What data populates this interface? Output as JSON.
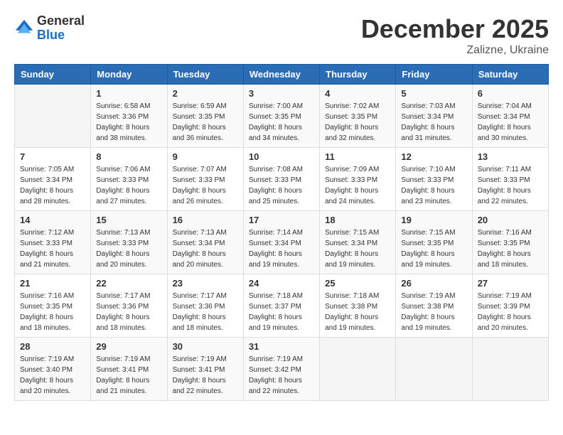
{
  "header": {
    "logo": {
      "general": "General",
      "blue": "Blue"
    },
    "title": "December 2025",
    "location": "Zalizne, Ukraine"
  },
  "weekdays": [
    "Sunday",
    "Monday",
    "Tuesday",
    "Wednesday",
    "Thursday",
    "Friday",
    "Saturday"
  ],
  "weeks": [
    [
      {
        "day": "",
        "sunrise": "",
        "sunset": "",
        "daylight": ""
      },
      {
        "day": "1",
        "sunrise": "Sunrise: 6:58 AM",
        "sunset": "Sunset: 3:36 PM",
        "daylight": "Daylight: 8 hours and 38 minutes."
      },
      {
        "day": "2",
        "sunrise": "Sunrise: 6:59 AM",
        "sunset": "Sunset: 3:35 PM",
        "daylight": "Daylight: 8 hours and 36 minutes."
      },
      {
        "day": "3",
        "sunrise": "Sunrise: 7:00 AM",
        "sunset": "Sunset: 3:35 PM",
        "daylight": "Daylight: 8 hours and 34 minutes."
      },
      {
        "day": "4",
        "sunrise": "Sunrise: 7:02 AM",
        "sunset": "Sunset: 3:35 PM",
        "daylight": "Daylight: 8 hours and 32 minutes."
      },
      {
        "day": "5",
        "sunrise": "Sunrise: 7:03 AM",
        "sunset": "Sunset: 3:34 PM",
        "daylight": "Daylight: 8 hours and 31 minutes."
      },
      {
        "day": "6",
        "sunrise": "Sunrise: 7:04 AM",
        "sunset": "Sunset: 3:34 PM",
        "daylight": "Daylight: 8 hours and 30 minutes."
      }
    ],
    [
      {
        "day": "7",
        "sunrise": "Sunrise: 7:05 AM",
        "sunset": "Sunset: 3:34 PM",
        "daylight": "Daylight: 8 hours and 28 minutes."
      },
      {
        "day": "8",
        "sunrise": "Sunrise: 7:06 AM",
        "sunset": "Sunset: 3:33 PM",
        "daylight": "Daylight: 8 hours and 27 minutes."
      },
      {
        "day": "9",
        "sunrise": "Sunrise: 7:07 AM",
        "sunset": "Sunset: 3:33 PM",
        "daylight": "Daylight: 8 hours and 26 minutes."
      },
      {
        "day": "10",
        "sunrise": "Sunrise: 7:08 AM",
        "sunset": "Sunset: 3:33 PM",
        "daylight": "Daylight: 8 hours and 25 minutes."
      },
      {
        "day": "11",
        "sunrise": "Sunrise: 7:09 AM",
        "sunset": "Sunset: 3:33 PM",
        "daylight": "Daylight: 8 hours and 24 minutes."
      },
      {
        "day": "12",
        "sunrise": "Sunrise: 7:10 AM",
        "sunset": "Sunset: 3:33 PM",
        "daylight": "Daylight: 8 hours and 23 minutes."
      },
      {
        "day": "13",
        "sunrise": "Sunrise: 7:11 AM",
        "sunset": "Sunset: 3:33 PM",
        "daylight": "Daylight: 8 hours and 22 minutes."
      }
    ],
    [
      {
        "day": "14",
        "sunrise": "Sunrise: 7:12 AM",
        "sunset": "Sunset: 3:33 PM",
        "daylight": "Daylight: 8 hours and 21 minutes."
      },
      {
        "day": "15",
        "sunrise": "Sunrise: 7:13 AM",
        "sunset": "Sunset: 3:33 PM",
        "daylight": "Daylight: 8 hours and 20 minutes."
      },
      {
        "day": "16",
        "sunrise": "Sunrise: 7:13 AM",
        "sunset": "Sunset: 3:34 PM",
        "daylight": "Daylight: 8 hours and 20 minutes."
      },
      {
        "day": "17",
        "sunrise": "Sunrise: 7:14 AM",
        "sunset": "Sunset: 3:34 PM",
        "daylight": "Daylight: 8 hours and 19 minutes."
      },
      {
        "day": "18",
        "sunrise": "Sunrise: 7:15 AM",
        "sunset": "Sunset: 3:34 PM",
        "daylight": "Daylight: 8 hours and 19 minutes."
      },
      {
        "day": "19",
        "sunrise": "Sunrise: 7:15 AM",
        "sunset": "Sunset: 3:35 PM",
        "daylight": "Daylight: 8 hours and 19 minutes."
      },
      {
        "day": "20",
        "sunrise": "Sunrise: 7:16 AM",
        "sunset": "Sunset: 3:35 PM",
        "daylight": "Daylight: 8 hours and 18 minutes."
      }
    ],
    [
      {
        "day": "21",
        "sunrise": "Sunrise: 7:16 AM",
        "sunset": "Sunset: 3:35 PM",
        "daylight": "Daylight: 8 hours and 18 minutes."
      },
      {
        "day": "22",
        "sunrise": "Sunrise: 7:17 AM",
        "sunset": "Sunset: 3:36 PM",
        "daylight": "Daylight: 8 hours and 18 minutes."
      },
      {
        "day": "23",
        "sunrise": "Sunrise: 7:17 AM",
        "sunset": "Sunset: 3:36 PM",
        "daylight": "Daylight: 8 hours and 18 minutes."
      },
      {
        "day": "24",
        "sunrise": "Sunrise: 7:18 AM",
        "sunset": "Sunset: 3:37 PM",
        "daylight": "Daylight: 8 hours and 19 minutes."
      },
      {
        "day": "25",
        "sunrise": "Sunrise: 7:18 AM",
        "sunset": "Sunset: 3:38 PM",
        "daylight": "Daylight: 8 hours and 19 minutes."
      },
      {
        "day": "26",
        "sunrise": "Sunrise: 7:19 AM",
        "sunset": "Sunset: 3:38 PM",
        "daylight": "Daylight: 8 hours and 19 minutes."
      },
      {
        "day": "27",
        "sunrise": "Sunrise: 7:19 AM",
        "sunset": "Sunset: 3:39 PM",
        "daylight": "Daylight: 8 hours and 20 minutes."
      }
    ],
    [
      {
        "day": "28",
        "sunrise": "Sunrise: 7:19 AM",
        "sunset": "Sunset: 3:40 PM",
        "daylight": "Daylight: 8 hours and 20 minutes."
      },
      {
        "day": "29",
        "sunrise": "Sunrise: 7:19 AM",
        "sunset": "Sunset: 3:41 PM",
        "daylight": "Daylight: 8 hours and 21 minutes."
      },
      {
        "day": "30",
        "sunrise": "Sunrise: 7:19 AM",
        "sunset": "Sunset: 3:41 PM",
        "daylight": "Daylight: 8 hours and 22 minutes."
      },
      {
        "day": "31",
        "sunrise": "Sunrise: 7:19 AM",
        "sunset": "Sunset: 3:42 PM",
        "daylight": "Daylight: 8 hours and 22 minutes."
      },
      {
        "day": "",
        "sunrise": "",
        "sunset": "",
        "daylight": ""
      },
      {
        "day": "",
        "sunrise": "",
        "sunset": "",
        "daylight": ""
      },
      {
        "day": "",
        "sunrise": "",
        "sunset": "",
        "daylight": ""
      }
    ]
  ]
}
